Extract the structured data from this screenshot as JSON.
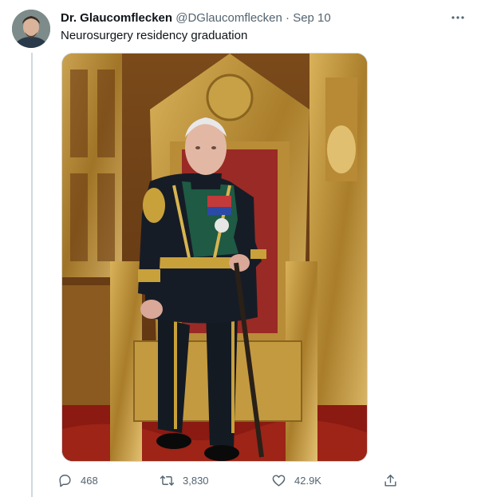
{
  "tweet": {
    "author_name": "Dr. Glaucomflecken",
    "handle": "@DGlaucomflecken",
    "separator": "·",
    "date": "Sep 10",
    "text": "Neurosurgery residency graduation",
    "media_description_icon": "photo"
  },
  "actions": {
    "reply_count": "468",
    "retweet_count": "3,830",
    "like_count": "42.9K"
  },
  "icons": [
    "more-icon",
    "reply-icon",
    "retweet-icon",
    "like-icon",
    "share-icon"
  ],
  "colors": {
    "text": "#0f1419",
    "secondary": "#536471",
    "border": "#cfd9de",
    "gold": "#c9a13b"
  }
}
